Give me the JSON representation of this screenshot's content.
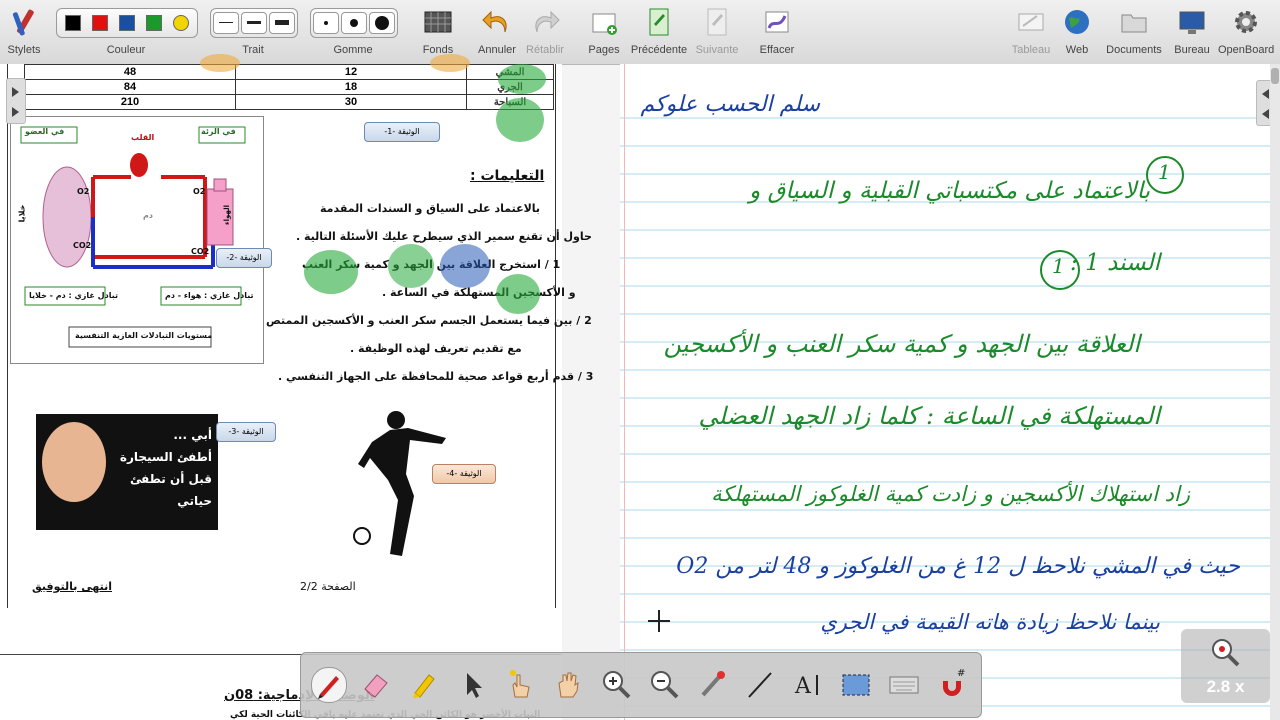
{
  "toolbar": {
    "stylets": "Stylets",
    "couleur": "Couleur",
    "trait": "Trait",
    "gomme": "Gomme",
    "fonds": "Fonds",
    "annuler": "Annuler",
    "retablir": "Rétablir",
    "pages": "Pages",
    "precedente": "Précédente",
    "suivante": "Suivante",
    "effacer": "Effacer",
    "tableau": "Tableau",
    "web": "Web",
    "documents": "Documents",
    "bureau": "Bureau",
    "openboard": "OpenBoard",
    "colors": [
      "#000000",
      "#e01010",
      "#1a4fa0",
      "#1a9a2a",
      "#f2d400"
    ]
  },
  "document": {
    "table_rows": [
      {
        "value": "48",
        "num": "12",
        "label": "المشي"
      },
      {
        "value": "84",
        "num": "18",
        "label": "الجري"
      },
      {
        "value": "210",
        "num": "30",
        "label": "السباحة"
      }
    ],
    "doc1_label": "الوثيقة -1-",
    "doc2_label": "الوثيقة -2-",
    "doc3_label": "الوثيقة -3-",
    "doc4_label": "الوثيقة -4-",
    "diagram": {
      "organ": "في العضو",
      "heart": "القلب",
      "lung": "في الرئة",
      "cells": "خلايا",
      "air": "الهواء",
      "blood": "دم",
      "exchange_tissue": "تبادل غازي : دم - خلايا",
      "exchange_lung": "تبادل غازي : هواء - دم",
      "caption": "مستويات التبادلات الغازية التنفسية",
      "o2": "O2",
      "co2": "CO2"
    },
    "instructions_title": "التعليمات :",
    "line1": "بالاعتماد على السياق و السندات المقدمة",
    "line2": "حاول أن تقنع سمير الذي سيطرح عليك الأسئلة التالية .",
    "line3": "1 / استخرج العلاقة بين الجهد و كمية سكر العنب",
    "line4": "و الأكسجين المستهلكة في الساعة .",
    "line5": "2 / بين فيما يستعمل الجسم سكر العنب و الأكسجين الممتص",
    "line6": "مع تقديم تعريف لهذه الوظيفة .",
    "line7": "3 / قدم أربع قواعد صحية للمحافظة على الجهاز التنفسي .",
    "poster": [
      "أبي ...",
      "أطفئ السيجارة",
      "قبل أن تطفئ",
      "حياتي"
    ],
    "page": "الصفحة 2/2",
    "end": "انتهى بالتوفيق",
    "next_title": "الوضعية الإدماجية: 08ن",
    "next_line": "النبات الأخضر هو الكائن الحي الذي تعتمد عليه باقي الكائنات الحية لكي"
  },
  "notebook": {
    "line1": "سلم الحسب علوكم",
    "line2": "بالاعتماد على مكتسباتي القبلية و السياق و",
    "line3": "السند 1 :",
    "line4": "العلاقة بين الجهد و كمية سكر العنب و الأكسجين",
    "line5": "المستهلكة في الساعة : كلما زاد الجهد العضلي",
    "line6": "زاد استهلاك الأكسجين و زادت كمية الغلوكوز المستهلكة",
    "line7": "حيث في المشي نلاحظ ل 12 غ من الغلوكوز و 48 لتر من O2",
    "line8": "بينما نلاحظ زيادة هاته القيمة في الجري",
    "circled1": "1",
    "circled2": "1"
  },
  "zoom": {
    "level": "2.8 x"
  }
}
